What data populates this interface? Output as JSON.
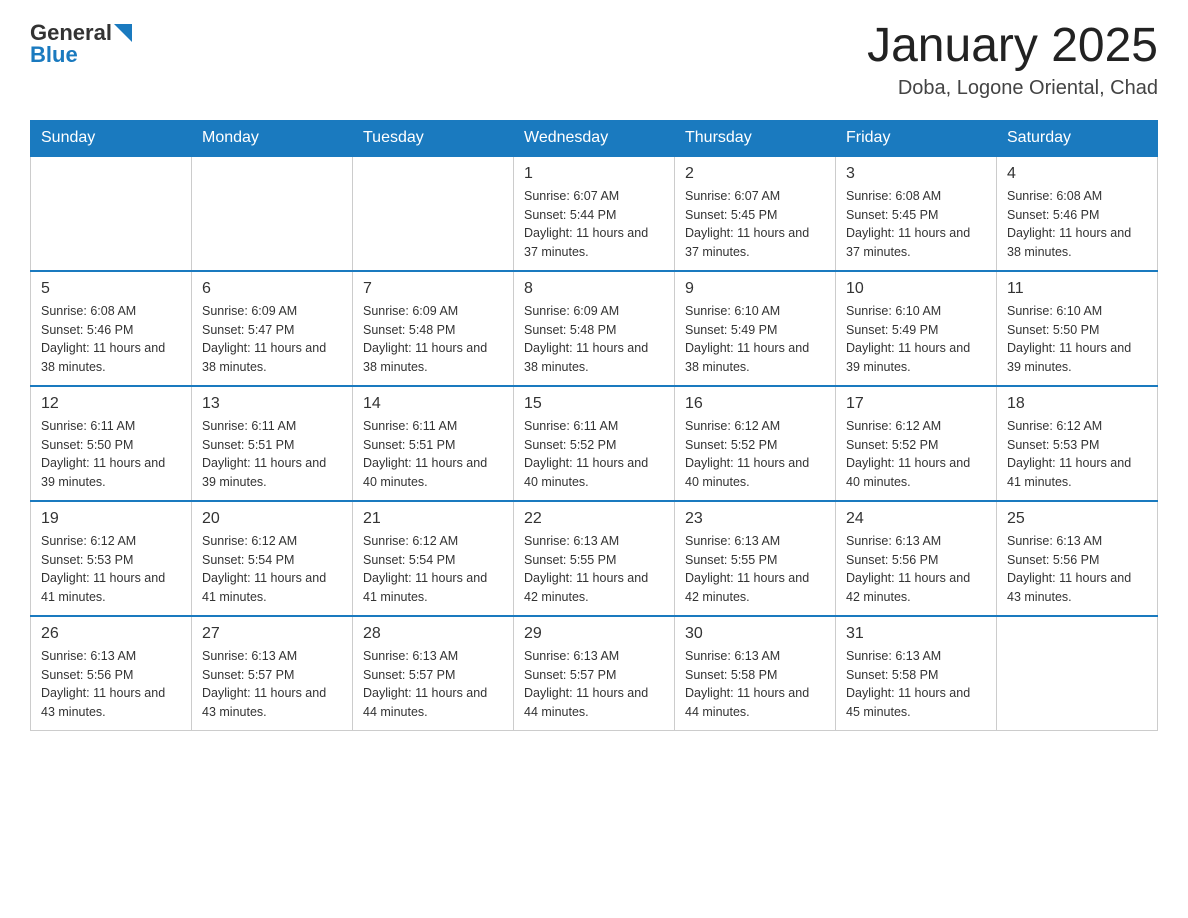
{
  "header": {
    "logo": {
      "general": "General",
      "blue": "Blue"
    },
    "title": "January 2025",
    "location": "Doba, Logone Oriental, Chad"
  },
  "weekdays": [
    "Sunday",
    "Monday",
    "Tuesday",
    "Wednesday",
    "Thursday",
    "Friday",
    "Saturday"
  ],
  "weeks": [
    [
      {
        "day": "",
        "info": ""
      },
      {
        "day": "",
        "info": ""
      },
      {
        "day": "",
        "info": ""
      },
      {
        "day": "1",
        "info": "Sunrise: 6:07 AM\nSunset: 5:44 PM\nDaylight: 11 hours and 37 minutes."
      },
      {
        "day": "2",
        "info": "Sunrise: 6:07 AM\nSunset: 5:45 PM\nDaylight: 11 hours and 37 minutes."
      },
      {
        "day": "3",
        "info": "Sunrise: 6:08 AM\nSunset: 5:45 PM\nDaylight: 11 hours and 37 minutes."
      },
      {
        "day": "4",
        "info": "Sunrise: 6:08 AM\nSunset: 5:46 PM\nDaylight: 11 hours and 38 minutes."
      }
    ],
    [
      {
        "day": "5",
        "info": "Sunrise: 6:08 AM\nSunset: 5:46 PM\nDaylight: 11 hours and 38 minutes."
      },
      {
        "day": "6",
        "info": "Sunrise: 6:09 AM\nSunset: 5:47 PM\nDaylight: 11 hours and 38 minutes."
      },
      {
        "day": "7",
        "info": "Sunrise: 6:09 AM\nSunset: 5:48 PM\nDaylight: 11 hours and 38 minutes."
      },
      {
        "day": "8",
        "info": "Sunrise: 6:09 AM\nSunset: 5:48 PM\nDaylight: 11 hours and 38 minutes."
      },
      {
        "day": "9",
        "info": "Sunrise: 6:10 AM\nSunset: 5:49 PM\nDaylight: 11 hours and 38 minutes."
      },
      {
        "day": "10",
        "info": "Sunrise: 6:10 AM\nSunset: 5:49 PM\nDaylight: 11 hours and 39 minutes."
      },
      {
        "day": "11",
        "info": "Sunrise: 6:10 AM\nSunset: 5:50 PM\nDaylight: 11 hours and 39 minutes."
      }
    ],
    [
      {
        "day": "12",
        "info": "Sunrise: 6:11 AM\nSunset: 5:50 PM\nDaylight: 11 hours and 39 minutes."
      },
      {
        "day": "13",
        "info": "Sunrise: 6:11 AM\nSunset: 5:51 PM\nDaylight: 11 hours and 39 minutes."
      },
      {
        "day": "14",
        "info": "Sunrise: 6:11 AM\nSunset: 5:51 PM\nDaylight: 11 hours and 40 minutes."
      },
      {
        "day": "15",
        "info": "Sunrise: 6:11 AM\nSunset: 5:52 PM\nDaylight: 11 hours and 40 minutes."
      },
      {
        "day": "16",
        "info": "Sunrise: 6:12 AM\nSunset: 5:52 PM\nDaylight: 11 hours and 40 minutes."
      },
      {
        "day": "17",
        "info": "Sunrise: 6:12 AM\nSunset: 5:52 PM\nDaylight: 11 hours and 40 minutes."
      },
      {
        "day": "18",
        "info": "Sunrise: 6:12 AM\nSunset: 5:53 PM\nDaylight: 11 hours and 41 minutes."
      }
    ],
    [
      {
        "day": "19",
        "info": "Sunrise: 6:12 AM\nSunset: 5:53 PM\nDaylight: 11 hours and 41 minutes."
      },
      {
        "day": "20",
        "info": "Sunrise: 6:12 AM\nSunset: 5:54 PM\nDaylight: 11 hours and 41 minutes."
      },
      {
        "day": "21",
        "info": "Sunrise: 6:12 AM\nSunset: 5:54 PM\nDaylight: 11 hours and 41 minutes."
      },
      {
        "day": "22",
        "info": "Sunrise: 6:13 AM\nSunset: 5:55 PM\nDaylight: 11 hours and 42 minutes."
      },
      {
        "day": "23",
        "info": "Sunrise: 6:13 AM\nSunset: 5:55 PM\nDaylight: 11 hours and 42 minutes."
      },
      {
        "day": "24",
        "info": "Sunrise: 6:13 AM\nSunset: 5:56 PM\nDaylight: 11 hours and 42 minutes."
      },
      {
        "day": "25",
        "info": "Sunrise: 6:13 AM\nSunset: 5:56 PM\nDaylight: 11 hours and 43 minutes."
      }
    ],
    [
      {
        "day": "26",
        "info": "Sunrise: 6:13 AM\nSunset: 5:56 PM\nDaylight: 11 hours and 43 minutes."
      },
      {
        "day": "27",
        "info": "Sunrise: 6:13 AM\nSunset: 5:57 PM\nDaylight: 11 hours and 43 minutes."
      },
      {
        "day": "28",
        "info": "Sunrise: 6:13 AM\nSunset: 5:57 PM\nDaylight: 11 hours and 44 minutes."
      },
      {
        "day": "29",
        "info": "Sunrise: 6:13 AM\nSunset: 5:57 PM\nDaylight: 11 hours and 44 minutes."
      },
      {
        "day": "30",
        "info": "Sunrise: 6:13 AM\nSunset: 5:58 PM\nDaylight: 11 hours and 44 minutes."
      },
      {
        "day": "31",
        "info": "Sunrise: 6:13 AM\nSunset: 5:58 PM\nDaylight: 11 hours and 45 minutes."
      },
      {
        "day": "",
        "info": ""
      }
    ]
  ]
}
